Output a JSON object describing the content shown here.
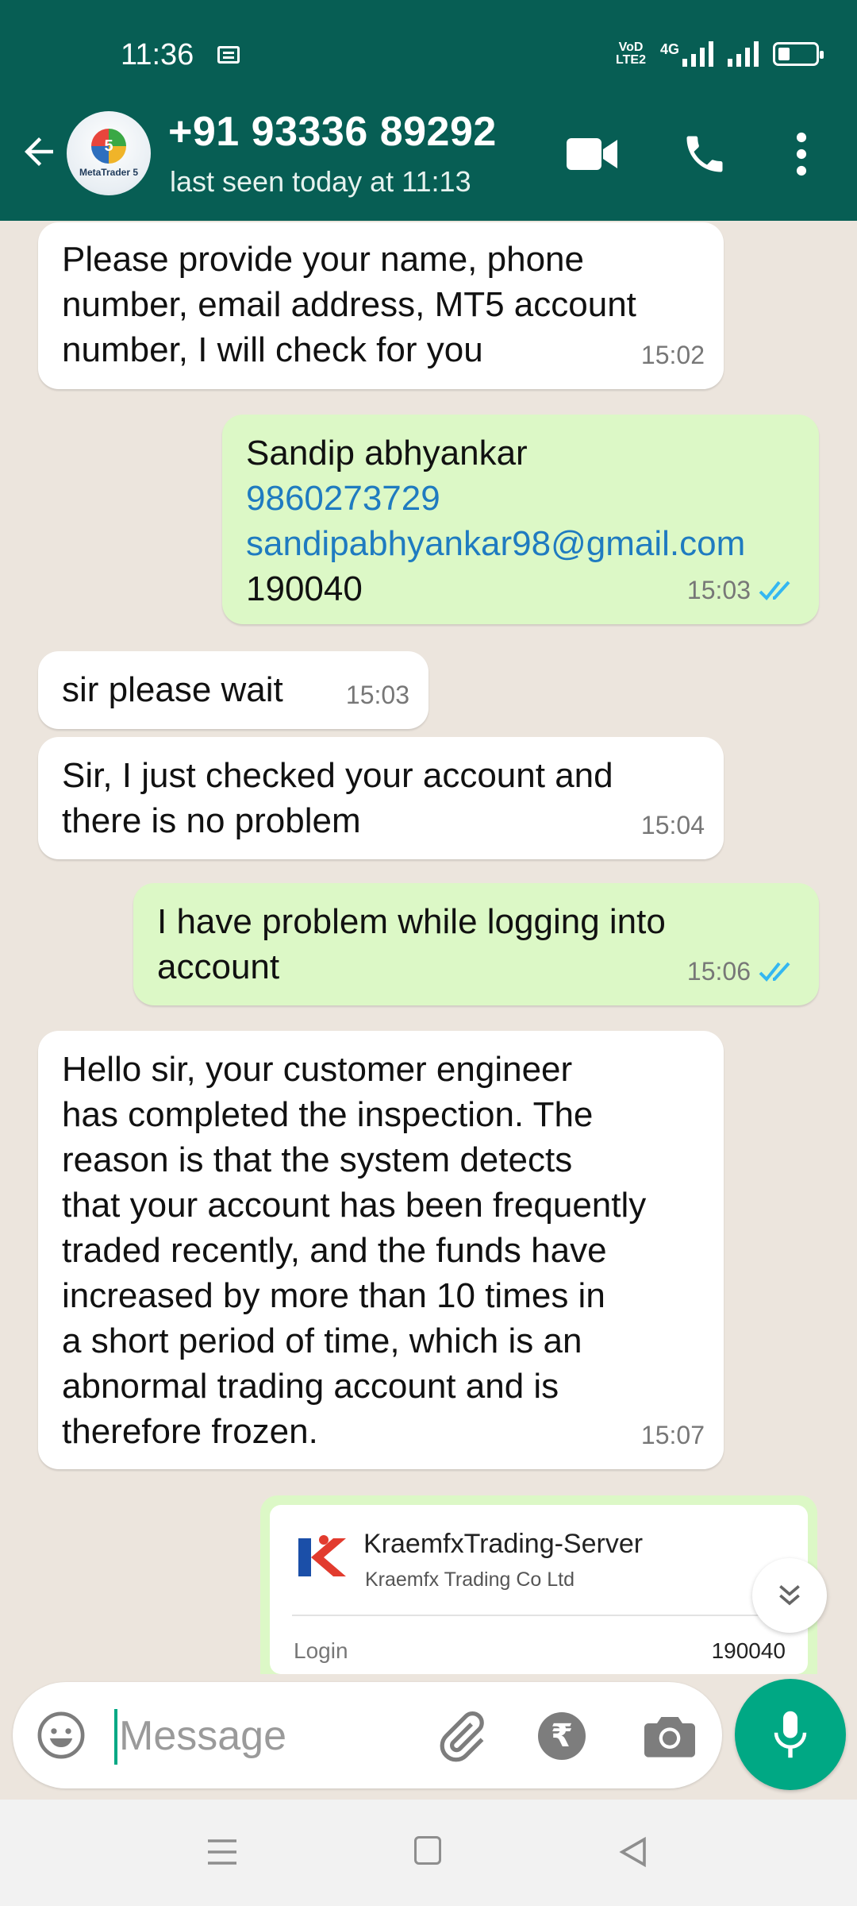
{
  "status_bar": {
    "time": "11:36",
    "network_line1": "VoD",
    "network_line2": "LTE2",
    "network_type": "4G"
  },
  "header": {
    "contact_name": "+91 93336 89292",
    "last_seen": "last seen today at 11:13",
    "avatar_text": "MetaTrader 5",
    "avatar_badge": "5",
    "color": "#075e54"
  },
  "messages": [
    {
      "direction": "in",
      "text": "Please provide your name, phone\nnumber, email address, MT5 account\nnumber, I will check for you",
      "time": "15:02"
    },
    {
      "direction": "out",
      "name": "Sandip abhyankar",
      "phone": "9860273729",
      "email": "sandipabhyankar98@gmail.com",
      "account": "190040",
      "time": "15:03",
      "status": "read"
    },
    {
      "direction": "in",
      "text": "sir please wait",
      "time": "15:03"
    },
    {
      "direction": "in",
      "text": "Sir, I just checked your account and\nthere is no problem",
      "time": "15:04"
    },
    {
      "direction": "out",
      "text": "I have problem while logging into\naccount",
      "time": "15:06",
      "status": "read"
    },
    {
      "direction": "in",
      "text": "Hello sir, your customer engineer\nhas completed the inspection. The\nreason is that the system detects\nthat your account has been frequently\ntraded recently, and the funds have\nincreased by more than 10 times in\na short period of time, which is an\nabnormal trading account and is\ntherefore frozen.",
      "time": "15:07"
    }
  ],
  "card": {
    "title": "KraemfxTrading-Server",
    "subtitle": "Kraemfx Trading Co Ltd",
    "login_label": "Login",
    "login_value": "190040"
  },
  "composer": {
    "placeholder": "Message",
    "rupee_symbol": "₹"
  },
  "colors": {
    "incoming": "#ffffff",
    "outgoing": "#dcf8c6",
    "accent": "#00a884",
    "read_ticks": "#34b7f1",
    "link": "#1f7bc0"
  }
}
